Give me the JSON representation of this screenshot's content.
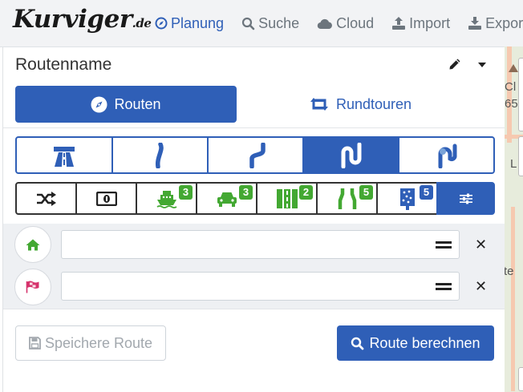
{
  "header": {
    "logo": {
      "main": "Kurviger",
      "tld": ".de"
    },
    "nav": [
      {
        "label": "Planung",
        "icon": "compass-icon",
        "active": true
      },
      {
        "label": "Suche",
        "icon": "search-icon"
      },
      {
        "label": "Cloud",
        "icon": "cloud-icon"
      },
      {
        "label": "Import",
        "icon": "upload-icon"
      },
      {
        "label": "Export",
        "icon": "download-icon"
      }
    ]
  },
  "map": {
    "labels": [
      "Cl",
      "65",
      "L",
      "te"
    ]
  },
  "panel": {
    "route_name": "Routenname",
    "tabs": [
      {
        "label": "Routen",
        "icon": "compass-icon",
        "active": true
      },
      {
        "label": "Rundtouren",
        "icon": "retweet-icon",
        "active": false
      }
    ],
    "curviness": [
      {
        "name": "highway",
        "icon": "highway-icon"
      },
      {
        "name": "slightly-curvy",
        "icon": "slight-curve-icon"
      },
      {
        "name": "curvy",
        "icon": "curve-icon"
      },
      {
        "name": "very-curvy",
        "icon": "very-curvy-icon",
        "selected": true
      },
      {
        "name": "extremely-curvy",
        "icon": "extreme-curve-icon"
      }
    ],
    "options": [
      {
        "name": "random",
        "icon": "shuffle-icon"
      },
      {
        "name": "toll",
        "icon": "money-icon"
      },
      {
        "name": "ferry",
        "icon": "ferry-icon",
        "badge": "3"
      },
      {
        "name": "car-train",
        "icon": "car-icon",
        "badge": "3"
      },
      {
        "name": "unpaved",
        "icon": "road-icon",
        "badge": "2"
      },
      {
        "name": "narrow",
        "icon": "narrow-road-icon",
        "badge": "5"
      },
      {
        "name": "scenic",
        "icon": "scenic-icon",
        "badge": "5"
      },
      {
        "name": "settings",
        "icon": "sliders-icon",
        "selected": true
      }
    ],
    "waypoints": [
      {
        "icon": "home-icon",
        "value": ""
      },
      {
        "icon": "flag-icon",
        "value": ""
      }
    ],
    "buttons": {
      "save": "Speichere Route",
      "calculate": "Route berechnen"
    }
  },
  "colors": {
    "primary": "#2f5fb7",
    "badge_green": "#43a832",
    "home_green": "#43a832",
    "flag_pink": "#d6336c"
  }
}
